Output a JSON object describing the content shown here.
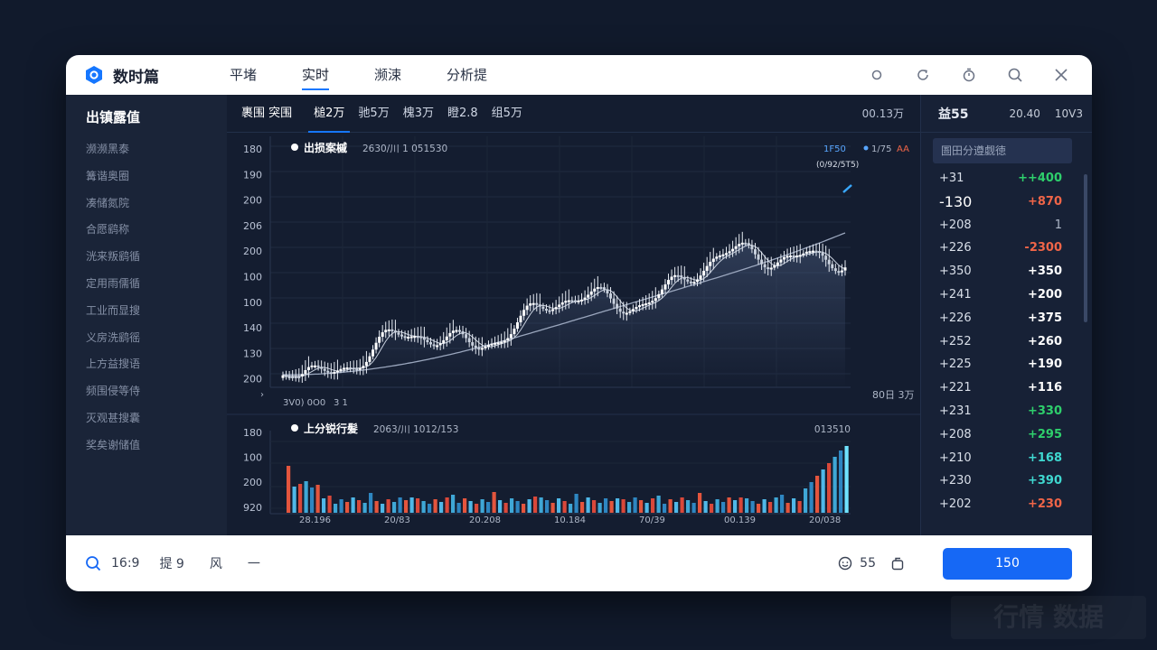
{
  "app": {
    "name": "数时篇"
  },
  "nav": {
    "items": [
      "平堵",
      "实时",
      "濒涑",
      "分析提"
    ],
    "active_index": 1
  },
  "sidebar": {
    "title": "出镇露值",
    "items": [
      "濒濒黑泰",
      "篝谐奥圈",
      "凑储氮院",
      "合愿鹞称",
      "洸来叛鹞循",
      "定用雨儒循",
      "工业而显搜",
      "义房洗鹞徭",
      "上方益搜语",
      "频围侵等侍",
      "灭观甚搜囊",
      "奖矣谢储值"
    ]
  },
  "subtabs": {
    "items": [
      "裹围 突围",
      "槌2万",
      "驰5万",
      "槐3万",
      "瞪2.8",
      "组5万"
    ],
    "active_index": 1,
    "right_label": "00.13万"
  },
  "main_chart": {
    "title": "出损案槭",
    "subtitle": "2630/川 1 051530",
    "legend_a": "1F50",
    "legend_b": "1/75",
    "legend_c": "AA",
    "peak_label": "(0/92/5T5)",
    "y_labels": [
      "180",
      "190",
      "200",
      "206",
      "200",
      "100",
      "100",
      "140",
      "130",
      "200"
    ],
    "x_start_label": "3V0) 0O0",
    "x_second_label": "3 1",
    "x_corner_label": "›",
    "bottom_right_label": "80日 3万"
  },
  "volume_chart": {
    "title": "上分锐行髪",
    "subtitle": "2063/川 1012/153",
    "right_label": "013510",
    "y_labels": [
      "180",
      "100",
      "200",
      "920"
    ],
    "x_labels": [
      "28.196",
      "20/83",
      "20.208",
      "10.184",
      "70/39",
      "00.139",
      "20/038"
    ]
  },
  "right_panel": {
    "head": [
      "益55",
      "20.40",
      "10V3"
    ],
    "search_placeholder": "圄田分遵觑徳",
    "rows": [
      {
        "a": "+31",
        "b": "++400",
        "tone": "green"
      },
      {
        "a": "-130",
        "b": "+870",
        "tone": "red",
        "big": true
      },
      {
        "a": "+208",
        "b": "1",
        "tone": "gray"
      },
      {
        "a": "+226",
        "b": "-2300",
        "tone": "red"
      },
      {
        "a": "+350",
        "b": "+350",
        "tone": "white"
      },
      {
        "a": "+241",
        "b": "+200",
        "tone": "white"
      },
      {
        "a": "+226",
        "b": "+375",
        "tone": "white"
      },
      {
        "a": "+252",
        "b": "+260",
        "tone": "white"
      },
      {
        "a": "+225",
        "b": "+190",
        "tone": "white"
      },
      {
        "a": "+221",
        "b": "+116",
        "tone": "white"
      },
      {
        "a": "+231",
        "b": "+330",
        "tone": "green"
      },
      {
        "a": "+208",
        "b": "+295",
        "tone": "green"
      },
      {
        "a": "+210",
        "b": "+168",
        "tone": "teal"
      },
      {
        "a": "+230",
        "b": "+390",
        "tone": "teal"
      },
      {
        "a": "+202",
        "b": "+230",
        "tone": "red"
      }
    ]
  },
  "bottombar": {
    "ratio": "16:9",
    "item_b": "提 9",
    "item_c": "风",
    "item_d": "一",
    "count": "55",
    "primary_button": "150"
  },
  "watermark": "行情 数据"
}
